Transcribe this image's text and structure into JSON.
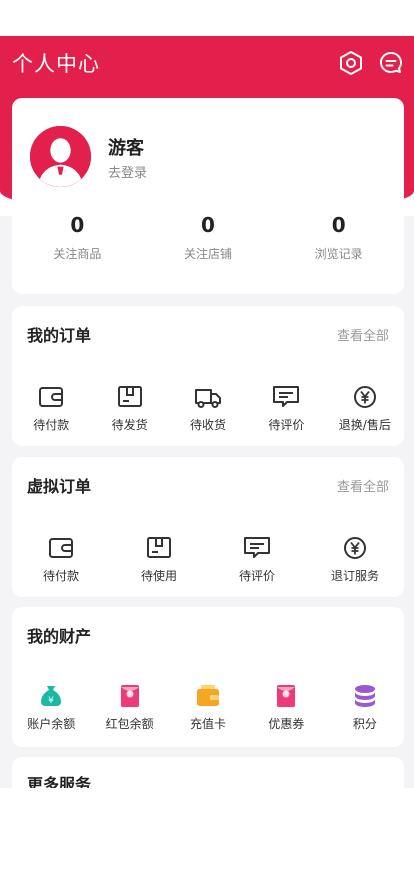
{
  "header": {
    "title": "个人中心",
    "icons": [
      "settings-hex-icon",
      "message-bubble-icon"
    ]
  },
  "profile": {
    "name": "游客",
    "login_text": "去登录",
    "stats": [
      {
        "value": "0",
        "label": "关注商品"
      },
      {
        "value": "0",
        "label": "关注店铺"
      },
      {
        "value": "0",
        "label": "浏览记录"
      }
    ]
  },
  "orders": {
    "title": "我的订单",
    "view_all": "查看全部",
    "items": [
      {
        "label": "待付款",
        "icon": "wallet-icon"
      },
      {
        "label": "待发货",
        "icon": "box-icon"
      },
      {
        "label": "待收货",
        "icon": "truck-icon"
      },
      {
        "label": "待评价",
        "icon": "comment-icon"
      },
      {
        "label": "退换/售后",
        "icon": "yen-circle-icon"
      }
    ]
  },
  "virtual_orders": {
    "title": "虚拟订单",
    "view_all": "查看全部",
    "items": [
      {
        "label": "待付款",
        "icon": "wallet-icon"
      },
      {
        "label": "待使用",
        "icon": "box-icon"
      },
      {
        "label": "待评价",
        "icon": "comment-icon"
      },
      {
        "label": "退订服务",
        "icon": "yen-circle-icon"
      }
    ]
  },
  "assets": {
    "title": "我的财产",
    "items": [
      {
        "label": "账户余额",
        "icon": "money-bag-icon"
      },
      {
        "label": "红包余额",
        "icon": "red-envelope-icon"
      },
      {
        "label": "充值卡",
        "icon": "card-wallet-icon"
      },
      {
        "label": "优惠券",
        "icon": "coupon-icon"
      },
      {
        "label": "积分",
        "icon": "coins-stack-icon"
      }
    ]
  },
  "more_services": {
    "title": "更多服务"
  },
  "colors": {
    "primary": "#e3204c",
    "background": "#f4f4f6",
    "money_bag": "#1bb9a3",
    "envelope": "#ee3a79",
    "card_wallet": "#f5a623",
    "coupon": "#ee3a79",
    "coins": "#9b59d0"
  }
}
